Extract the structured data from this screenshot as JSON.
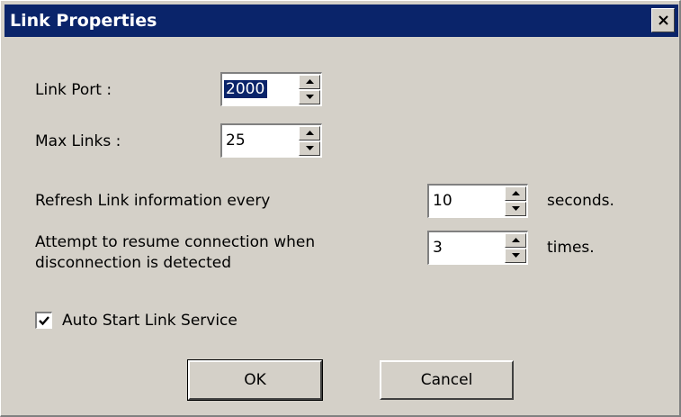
{
  "window": {
    "title": "Link Properties",
    "close_glyph": "x"
  },
  "fields": [
    {
      "label": "Link Port :",
      "value": "2000"
    },
    {
      "label": "Max Links :",
      "value": "25"
    },
    {
      "label": "Refresh Link information every",
      "value": "10",
      "unit": "seconds."
    },
    {
      "label_line1": "Attempt to resume connection when",
      "label_line2": "disconnection is detected",
      "value": "3",
      "unit": "times."
    }
  ],
  "auto_start": {
    "label": "Auto Start Link Service",
    "checked": true
  },
  "buttons": {
    "ok": "OK",
    "cancel": "Cancel"
  },
  "colors": {
    "face": "#d4d0c8",
    "titlebar": "#0a246a",
    "selection": "#0a246a"
  }
}
